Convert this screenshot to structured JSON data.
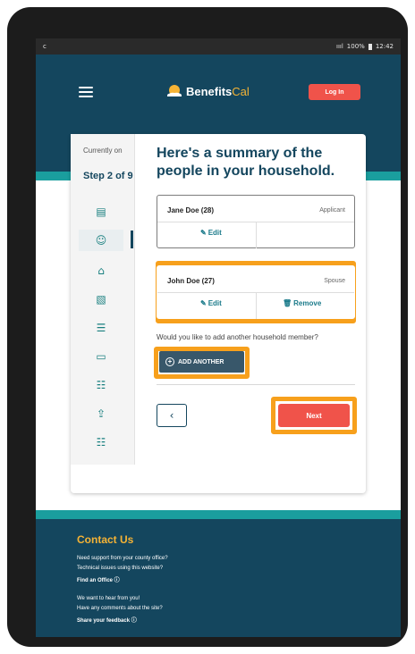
{
  "status_bar": {
    "left_icon": "c",
    "signal": "ıııl",
    "battery": "100%",
    "time": "12:42"
  },
  "header": {
    "brand_left": "Benefits",
    "brand_right": "Cal",
    "login_label": "Log In"
  },
  "sidebar": {
    "current_label": "Currently on",
    "step_label": "Step 2 of 9",
    "icons": [
      "id-card-icon",
      "people-icon",
      "house-icon",
      "money-icon",
      "document-icon",
      "car-icon",
      "list-icon",
      "upload-icon",
      "list-icon"
    ]
  },
  "main": {
    "title": "Here's a summary of the people in your household.",
    "people": [
      {
        "name": "Jane Doe (28)",
        "role": "Applicant",
        "edit_label": "Edit",
        "remove_label": ""
      },
      {
        "name": "John Doe (27)",
        "role": "Spouse",
        "edit_label": "Edit",
        "remove_label": "Remove"
      }
    ],
    "question": "Would you like to add another household member?",
    "add_label": "ADD ANOTHER",
    "back_symbol": "‹",
    "next_label": "Next"
  },
  "footer": {
    "title": "Contact Us",
    "lines": [
      {
        "text": "Need support from your county office?",
        "bold": false
      },
      {
        "text": "Technical issues using this website?",
        "bold": false
      },
      {
        "text": "Find an Office ⓘ",
        "bold": true
      },
      {
        "text": "We want to hear from you!",
        "bold": false
      },
      {
        "text": "Have any comments about the site?",
        "bold": false
      },
      {
        "text": "Share your feedback ⓘ",
        "bold": true
      }
    ]
  },
  "colors": {
    "primary": "#14465e",
    "accent": "#f0534a",
    "teal": "#1a9e9e",
    "gold": "#f5b335",
    "highlight": "#f7a01c"
  }
}
